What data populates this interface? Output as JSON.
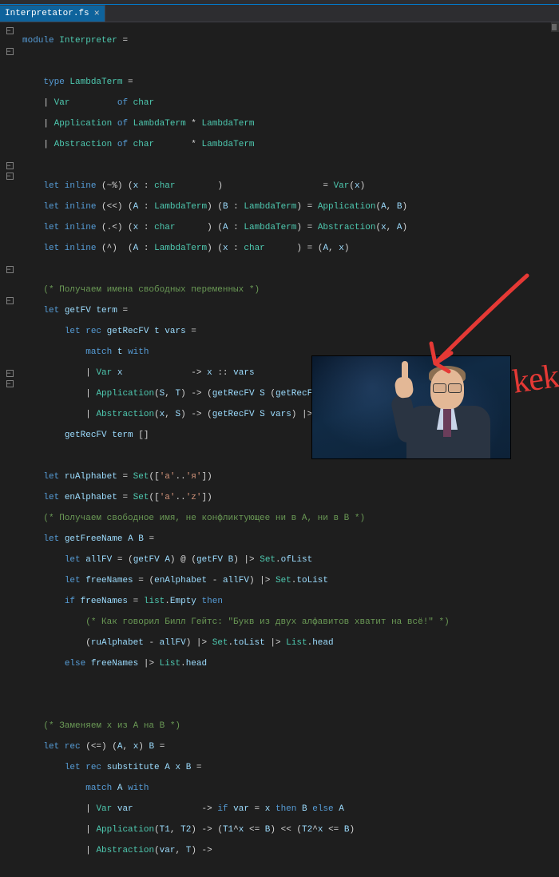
{
  "tab": {
    "filename": "Interpretator.fs",
    "close_glyph": "×"
  },
  "annotation": {
    "text": "kek"
  },
  "code": {
    "l1": "module Interpreter =",
    "l2": "",
    "l3": "    type LambdaTerm =",
    "l4": "    | Var         of char",
    "l5": "    | Application of LambdaTerm * LambdaTerm",
    "l6": "    | Abstraction of char       * LambdaTerm",
    "l7": "",
    "l8": "    let inline (~%) (x : char        )                   = Var(x)",
    "l9": "    let inline (<<) (A : LambdaTerm) (B : LambdaTerm) = Application(A, B)",
    "l10": "    let inline (.<) (x : char      ) (A : LambdaTerm) = Abstraction(x, A)",
    "l11": "    let inline (^)  (A : LambdaTerm) (x : char      ) = (A, x)",
    "l12": "",
    "l13": "    (* Получаем имена свободных переменных *)",
    "l14": "    let getFV term =",
    "l15": "        let rec getRecFV t vars =",
    "l16": "            match t with",
    "l17": "            | Var x             -> x :: vars",
    "l18": "            | Application(S, T) -> (getRecFV S (getRecFV T vars))",
    "l19": "            | Abstraction(x, S) -> (getRecFV S vars) |> List.filter(fun v -> v <> x)",
    "l20": "        getRecFV term []",
    "l21": "",
    "l22": "    let ruAlphabet = Set(['а'..'я'])",
    "l23": "    let enAlphabet = Set(['a'..'z'])",
    "l24": "    (* Получаем свободное имя, не конфликтующее ни в A, ни в B *)",
    "l25": "    let getFreeName A B =",
    "l26": "        let allFV = (getFV A) @ (getFV B) |> Set.ofList",
    "l27": "        let freeNames = (enAlphabet - allFV) |> Set.toList",
    "l28": "        if freeNames = list.Empty then",
    "l29": "            (* Как говорил Билл Гейтс: \"Букв из двух алфавитов хватит на всё!\" *)",
    "l30": "            (ruAlphabet - allFV) |> Set.toList |> List.head",
    "l31": "        else freeNames |> List.head",
    "l32": "",
    "l33": "",
    "l34": "    (* Заменяем x из A на B *)",
    "l35": "    let rec (<=) (A, x) B =",
    "l36": "        let rec substitute A x B =",
    "l37": "            match A with",
    "l38": "            | Var var             -> if var = x then B else A",
    "l39": "            | Application(T1, T2) -> (T1^x <= B) << (T2^x <= B)",
    "l40": "            | Abstraction(var, T) ->"
  }
}
